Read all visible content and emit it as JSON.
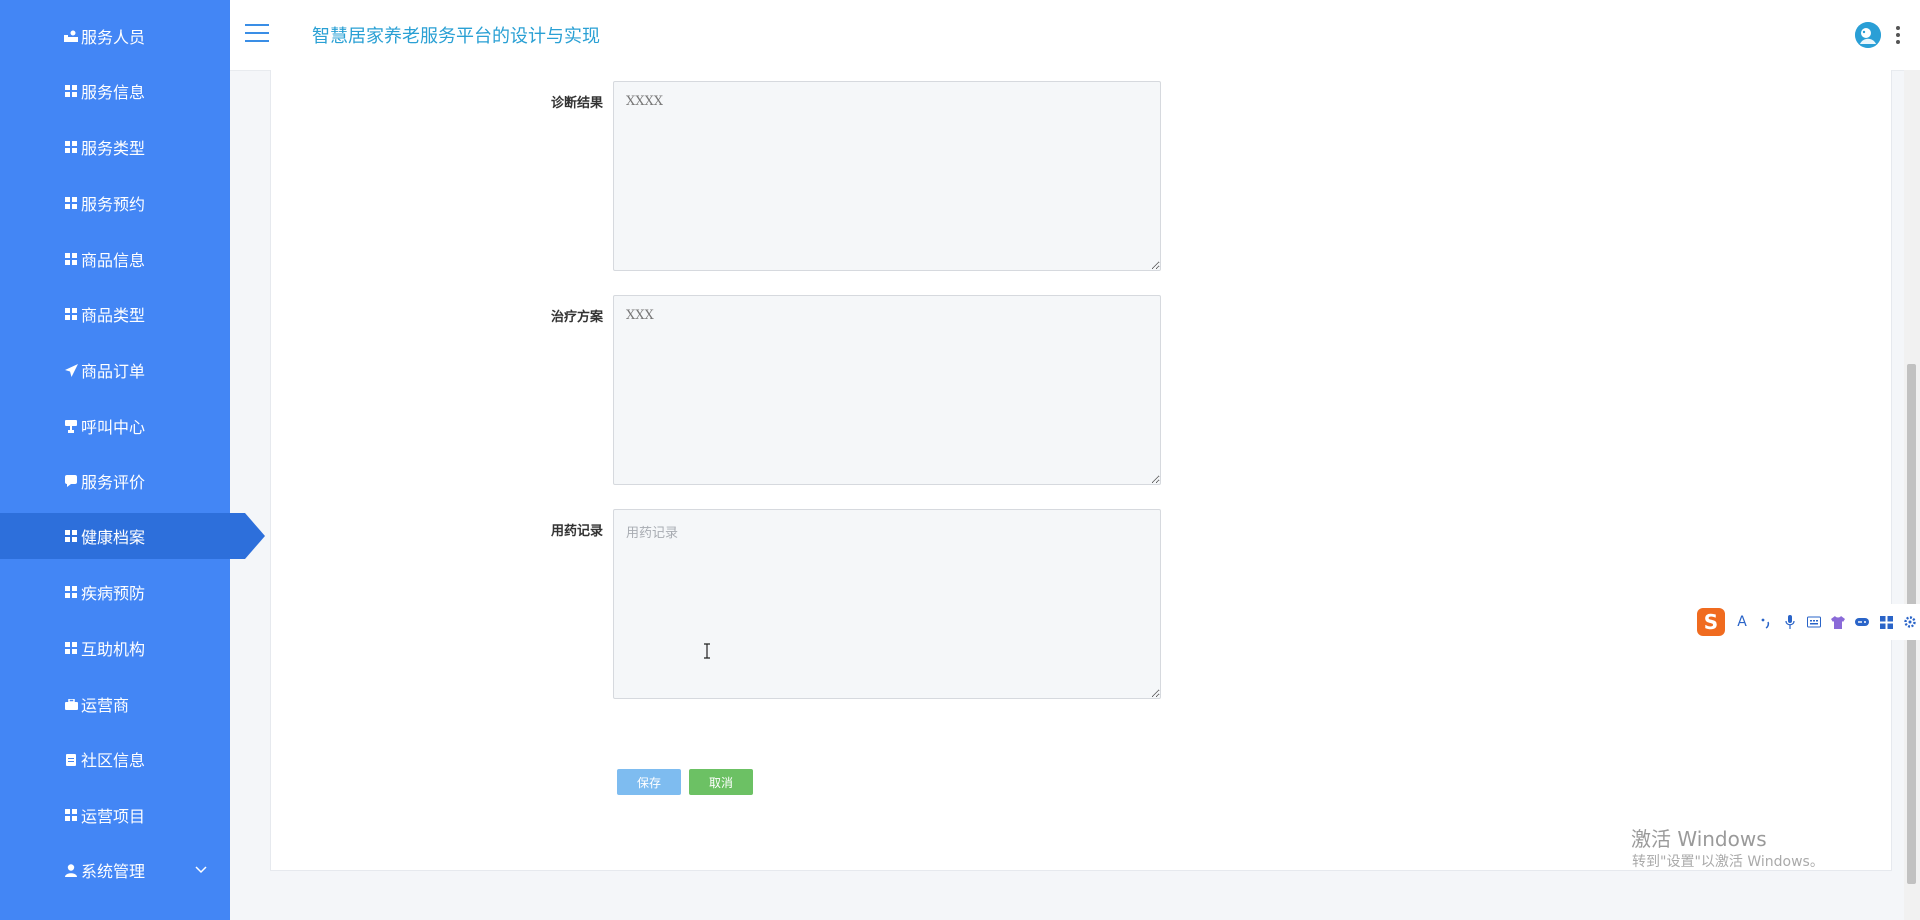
{
  "header": {
    "app_title": "智慧居家养老服务平台的设计与实现"
  },
  "sidebar": {
    "items": [
      {
        "label": "服务人员",
        "icon": "user-tie-icon"
      },
      {
        "label": "服务信息",
        "icon": "grid-icon"
      },
      {
        "label": "服务类型",
        "icon": "grid-icon"
      },
      {
        "label": "服务预约",
        "icon": "grid-icon"
      },
      {
        "label": "商品信息",
        "icon": "grid-icon"
      },
      {
        "label": "商品类型",
        "icon": "grid-icon"
      },
      {
        "label": "商品订单",
        "icon": "paper-plane-icon"
      },
      {
        "label": "呼叫中心",
        "icon": "trophy-icon"
      },
      {
        "label": "服务评价",
        "icon": "comment-icon"
      },
      {
        "label": "健康档案",
        "icon": "grid-icon",
        "active": true
      },
      {
        "label": "疾病预防",
        "icon": "grid-icon"
      },
      {
        "label": "互助机构",
        "icon": "grid-icon"
      },
      {
        "label": "运营商",
        "icon": "briefcase-icon"
      },
      {
        "label": "社区信息",
        "icon": "clipboard-icon"
      },
      {
        "label": "运营项目",
        "icon": "grid-icon"
      },
      {
        "label": "系统管理",
        "icon": "user-icon",
        "expandable": true
      }
    ]
  },
  "form": {
    "diagnosis": {
      "label": "诊断结果",
      "value": "XXXX"
    },
    "treatment": {
      "label": "治疗方案",
      "value": "XXX"
    },
    "medication": {
      "label": "用药记录",
      "value": "",
      "placeholder": "用药记录"
    },
    "save_label": "保存",
    "cancel_label": "取消"
  },
  "ime_toolbar": {
    "logo": "S",
    "letter": "A"
  },
  "watermark": {
    "line1": "激活 Windows",
    "line2": "转到\"设置\"以激活 Windows。"
  },
  "colors": {
    "sidebar": "#4386f5",
    "sidebar_active": "#2d6fdb",
    "title": "#2aa0d4",
    "save": "#7ebcf0",
    "cancel": "#6cc164"
  }
}
